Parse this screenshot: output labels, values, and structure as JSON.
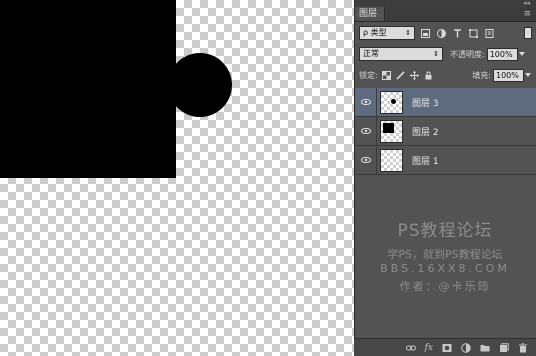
{
  "panel": {
    "title": "图层",
    "collapse_glyph": "◂◂",
    "menu_glyph": "≡",
    "filter": {
      "label": "ρ 类型",
      "icons": [
        "image-filter-icon",
        "adjustment-filter-icon",
        "type-filter-icon",
        "shape-filter-icon",
        "smart-object-filter-icon"
      ]
    },
    "blend_mode": "正常",
    "opacity_label": "不透明度:",
    "opacity_value": "100%",
    "lock_label": "锁定:",
    "fill_label": "填充:",
    "fill_value": "100%"
  },
  "layers": [
    {
      "name": "图层 3",
      "selected": true,
      "thumb": "circle"
    },
    {
      "name": "图层 2",
      "selected": false,
      "thumb": "square"
    },
    {
      "name": "图层 1",
      "selected": false,
      "thumb": "empty"
    }
  ],
  "watermark": {
    "line1": "PS教程论坛",
    "line2": "学PS，就到PS教程论坛",
    "line3": "BBS.16XX8.COM",
    "line4": "作者：@卡乐筠"
  },
  "footer": {
    "fx_label": "fx"
  },
  "colors": {
    "canvas_shape": "#000000",
    "panel_bg": "#535353",
    "selected_layer": "#5e6b7e"
  }
}
